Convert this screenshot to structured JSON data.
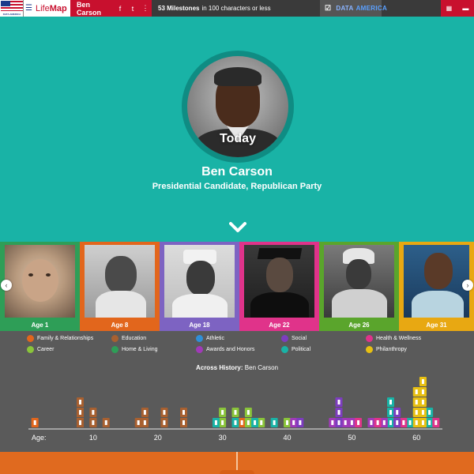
{
  "topbar": {
    "flag_text": "DATA AMERICA",
    "menu_icon": "hamburger-icon",
    "logo_prefix": "Life",
    "logo_suffix": "Map",
    "person_name": "Ben Carson",
    "share_icons": [
      "f",
      "t",
      "⋮"
    ],
    "milestones_count": "53 Milestones",
    "milestones_rest": "in 100 characters or less",
    "data_america_check": "☑",
    "data_label": "DATA",
    "america_label": "AMERICA",
    "grid_icons": [
      "▦",
      "▬"
    ]
  },
  "hero": {
    "today_label": "Today",
    "name": "Ben Carson",
    "subtitle": "Presidential Candidate, Republican Party",
    "bg_color": "#19b3a6"
  },
  "carousel": {
    "cards": [
      {
        "age": "Age 1",
        "color": "#2e9e57"
      },
      {
        "age": "Age 8",
        "color": "#e2661c"
      },
      {
        "age": "Age 18",
        "color": "#7d63c2"
      },
      {
        "age": "Age 22",
        "color": "#e0338a"
      },
      {
        "age": "Age 26",
        "color": "#5aa52c"
      },
      {
        "age": "Age 31",
        "color": "#e8a812"
      }
    ],
    "prev_icon": "‹",
    "next_icon": "›"
  },
  "legend": [
    {
      "label": "Family & Relationships",
      "color": "#e2661c"
    },
    {
      "label": "Education",
      "color": "#a86030"
    },
    {
      "label": "Athletic",
      "color": "#2f8fd8"
    },
    {
      "label": "Social",
      "color": "#7d3dbf"
    },
    {
      "label": "Health & Wellness",
      "color": "#e0338a"
    },
    {
      "label": "Career",
      "color": "#8ac43a"
    },
    {
      "label": "Home & Living",
      "color": "#2e9e57"
    },
    {
      "label": "Awards and Honors",
      "color": "#a03ab8"
    },
    {
      "label": "Political",
      "color": "#19b3a6"
    },
    {
      "label": "Philanthropy",
      "color": "#e8c012"
    }
  ],
  "timeline": {
    "title_bold": "Across History:",
    "title_rest": "Ben Carson",
    "axis_label": "Age:",
    "ticks": [
      "10",
      "20",
      "30",
      "40",
      "50",
      "60"
    ]
  },
  "chart_data": {
    "type": "scatter",
    "title": "Across History: Ben Carson",
    "xlabel": "Age:",
    "xlim": [
      0,
      64
    ],
    "x_ticks": [
      10,
      20,
      30,
      40,
      50,
      60
    ],
    "series": [
      {
        "name": "Family & Relationships",
        "x": [
          1,
          8,
          8,
          10,
          18,
          21,
          24,
          33,
          34
        ],
        "stack": [
          1,
          1,
          2,
          1,
          1,
          1,
          1,
          1,
          1
        ]
      },
      {
        "name": "Education",
        "x": [
          8,
          10,
          12,
          17,
          18,
          21,
          24
        ],
        "stack": [
          3,
          2,
          1,
          1,
          2,
          2,
          2
        ]
      },
      {
        "name": "Career",
        "x": [
          30,
          32,
          34,
          36,
          40
        ],
        "stack": [
          2,
          2,
          2,
          1,
          1
        ]
      },
      {
        "name": "Political",
        "x": [
          29,
          32,
          35,
          38,
          48,
          56,
          59,
          60,
          61,
          62
        ],
        "stack": [
          1,
          1,
          1,
          1,
          1,
          3,
          1,
          2,
          2,
          2
        ]
      },
      {
        "name": "Awards and Honors",
        "x": [
          41,
          47,
          48,
          49,
          50,
          53,
          55,
          57
        ],
        "stack": [
          1,
          1,
          2,
          1,
          1,
          1,
          1,
          1
        ]
      },
      {
        "name": "Health & Wellness",
        "x": [
          51,
          54,
          58,
          63
        ],
        "stack": [
          1,
          1,
          1,
          1
        ]
      },
      {
        "name": "Social",
        "x": [
          42,
          48,
          57
        ],
        "stack": [
          1,
          3,
          2
        ]
      },
      {
        "name": "Philanthropy",
        "x": [
          60,
          61
        ],
        "stack": [
          4,
          5
        ]
      }
    ]
  }
}
